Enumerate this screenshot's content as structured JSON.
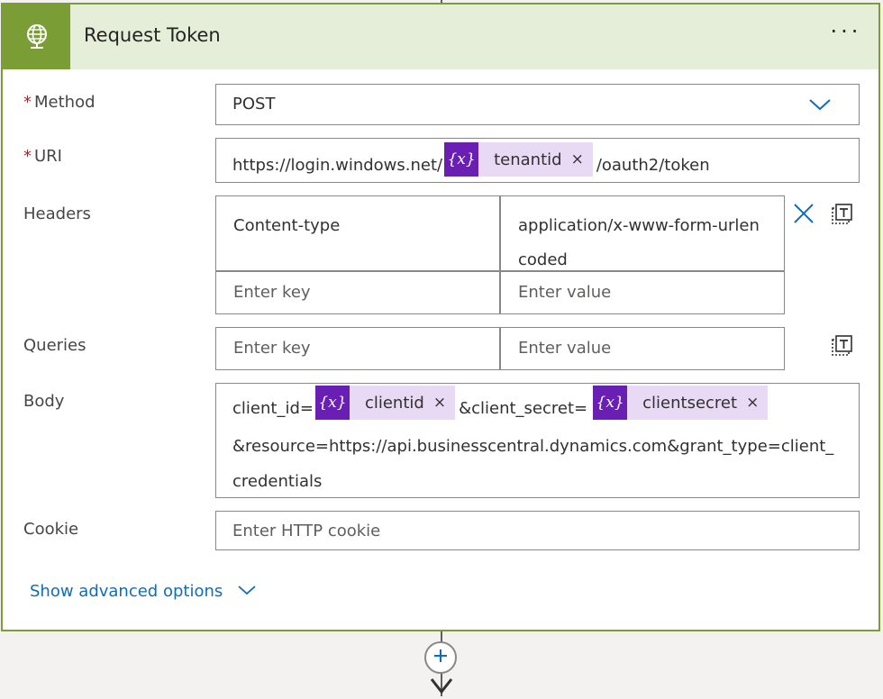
{
  "action": {
    "title": "Request Token",
    "more_label": "···"
  },
  "fields": {
    "method": {
      "label": "Method",
      "required_mark": "*",
      "value": "POST"
    },
    "uri": {
      "label": "URI",
      "required_mark": "*",
      "prefix": "https://login.windows.net/",
      "token": "tenantid",
      "suffix": "/oauth2/token"
    },
    "headers": {
      "label": "Headers",
      "rows": [
        {
          "key": "Content-type",
          "value": "application/x-www-form-urlencoded"
        }
      ],
      "key_placeholder": "Enter key",
      "value_placeholder": "Enter value"
    },
    "queries": {
      "label": "Queries",
      "key_placeholder": "Enter key",
      "value_placeholder": "Enter value"
    },
    "body": {
      "label": "Body",
      "part1": "client_id=",
      "token1": "clientid",
      "part2": "&client_secret=",
      "token2": "clientsecret",
      "part3": "&resource=https://api.businesscentral.dynamics.com&grant_type=client_credentials"
    },
    "cookie": {
      "label": "Cookie",
      "placeholder": "Enter HTTP cookie"
    }
  },
  "token_icon_text": "{x}",
  "token_close": "×",
  "advanced": {
    "label": "Show advanced options"
  },
  "colors": {
    "accent_green": "#7a9e35",
    "header_bg": "#e4eed9",
    "token_purple": "#6a1fb4",
    "token_bg": "#e8d9f5",
    "link_blue": "#0f6cbd"
  },
  "icons": [
    "globe-icon",
    "chevron-down-icon",
    "close-icon",
    "switch-to-text-icon",
    "plus-icon",
    "arrow-down-icon"
  ]
}
